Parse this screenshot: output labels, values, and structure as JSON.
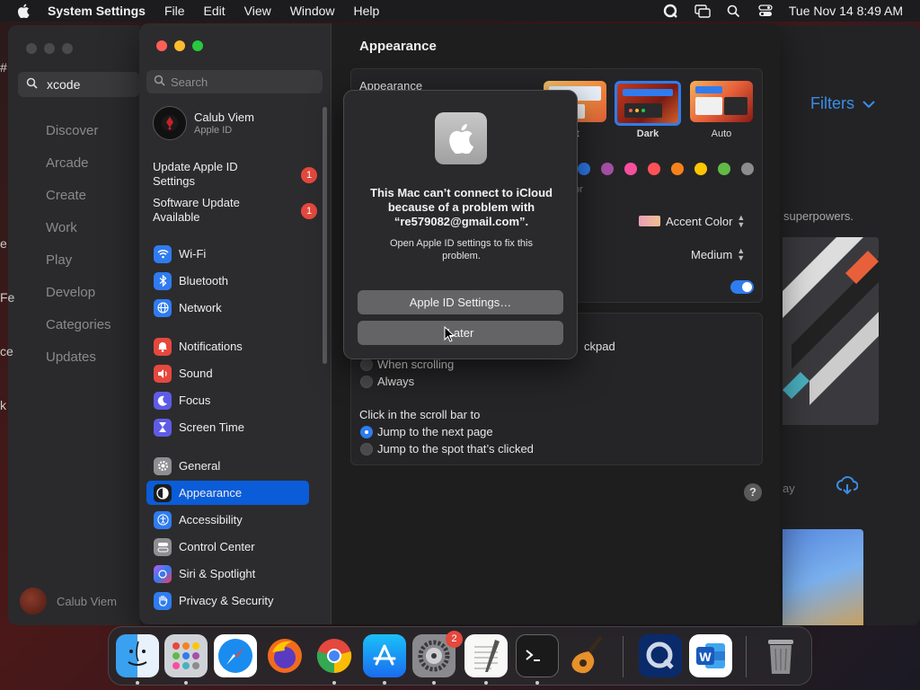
{
  "menubar": {
    "app_name": "System Settings",
    "items": [
      "File",
      "Edit",
      "View",
      "Window",
      "Help"
    ],
    "clock": "Tue Nov 14  8:49 AM",
    "icons": [
      "apple-icon",
      "quicktime-icon",
      "screen-mirror-icon",
      "spotlight-search-icon",
      "control-center-icon"
    ]
  },
  "appstore": {
    "search_value": "xcode",
    "nav": [
      "Discover",
      "Arcade",
      "Create",
      "Work",
      "Play",
      "Develop",
      "Categories",
      "Updates"
    ],
    "user": "Calub Viem",
    "filters": "Filters",
    "snippet": "superpowers.",
    "day_snippet": "ay",
    "left_letters": [
      "#",
      "e",
      "Fe",
      "ce",
      "k"
    ]
  },
  "settings": {
    "search_placeholder": "Search",
    "user_name": "Calub Viem",
    "user_sub": "Apple ID",
    "updates": [
      {
        "label_1": "Update Apple ID",
        "label_2": "Settings",
        "badge": "1"
      },
      {
        "label_1": "Software Update",
        "label_2": "Available",
        "badge": "1"
      }
    ],
    "sidebar": [
      {
        "label": "Wi-Fi",
        "icon": "wifi-icon",
        "color": "#2f7cf0"
      },
      {
        "label": "Bluetooth",
        "icon": "bluetooth-icon",
        "color": "#2f7cf0"
      },
      {
        "label": "Network",
        "icon": "globe-icon",
        "color": "#2f7cf0"
      },
      {
        "label": "Notifications",
        "icon": "bell-icon",
        "color": "#e5483d"
      },
      {
        "label": "Sound",
        "icon": "speaker-icon",
        "color": "#e5483d"
      },
      {
        "label": "Focus",
        "icon": "moon-icon",
        "color": "#5e5ce6"
      },
      {
        "label": "Screen Time",
        "icon": "hourglass-icon",
        "color": "#5e5ce6"
      },
      {
        "label": "General",
        "icon": "gear-icon",
        "color": "#8e8e93"
      },
      {
        "label": "Appearance",
        "icon": "appearance-icon",
        "color": "#1c1c1e"
      },
      {
        "label": "Accessibility",
        "icon": "accessibility-icon",
        "color": "#2f7cf0"
      },
      {
        "label": "Control Center",
        "icon": "toggles-icon",
        "color": "#8e8e93"
      },
      {
        "label": "Siri & Spotlight",
        "icon": "siri-icon",
        "color": "#bf5af2"
      },
      {
        "label": "Privacy & Security",
        "icon": "hand-icon",
        "color": "#2f7cf0"
      }
    ],
    "selected": "Appearance",
    "main_title": "Appearance",
    "appearance_label": "Appearance",
    "themes": [
      {
        "label": "nt"
      },
      {
        "label": "Dark"
      },
      {
        "label": "Auto"
      }
    ],
    "accent_colors": [
      "#2f7cf0",
      "#a550a7",
      "#f74f9e",
      "#ff5257",
      "#f7821b",
      "#ffc600",
      "#62ba46",
      "#8c8c8c"
    ],
    "accent_snippet": "or",
    "accent_color_label": "Accent Color",
    "highlight_color": "#e8a0b8",
    "sidebar_icon_size": "Medium",
    "scroll_snippet": "ckpad",
    "scroll_options": [
      "When scrolling",
      "Always"
    ],
    "click_label": "Click in the scroll bar to",
    "click_options": [
      "Jump to the next page",
      "Jump to the spot that’s clicked"
    ],
    "help": "?"
  },
  "alert": {
    "title": "This Mac can’t connect to iCloud because of a problem with “re579082@gmail.com”.",
    "message": "Open Apple ID settings to fix this problem.",
    "primary_button": "Apple ID Settings…",
    "secondary_button": "Later"
  },
  "dock": {
    "apps": [
      "finder-icon",
      "launchpad-icon",
      "safari-icon",
      "firefox-icon",
      "chrome-icon",
      "app-store-icon",
      "system-settings-icon",
      "textedit-icon",
      "terminal-icon",
      "garageband-icon",
      "quicktime-icon",
      "word-icon",
      "trash-icon"
    ],
    "settings_badge": "2"
  }
}
